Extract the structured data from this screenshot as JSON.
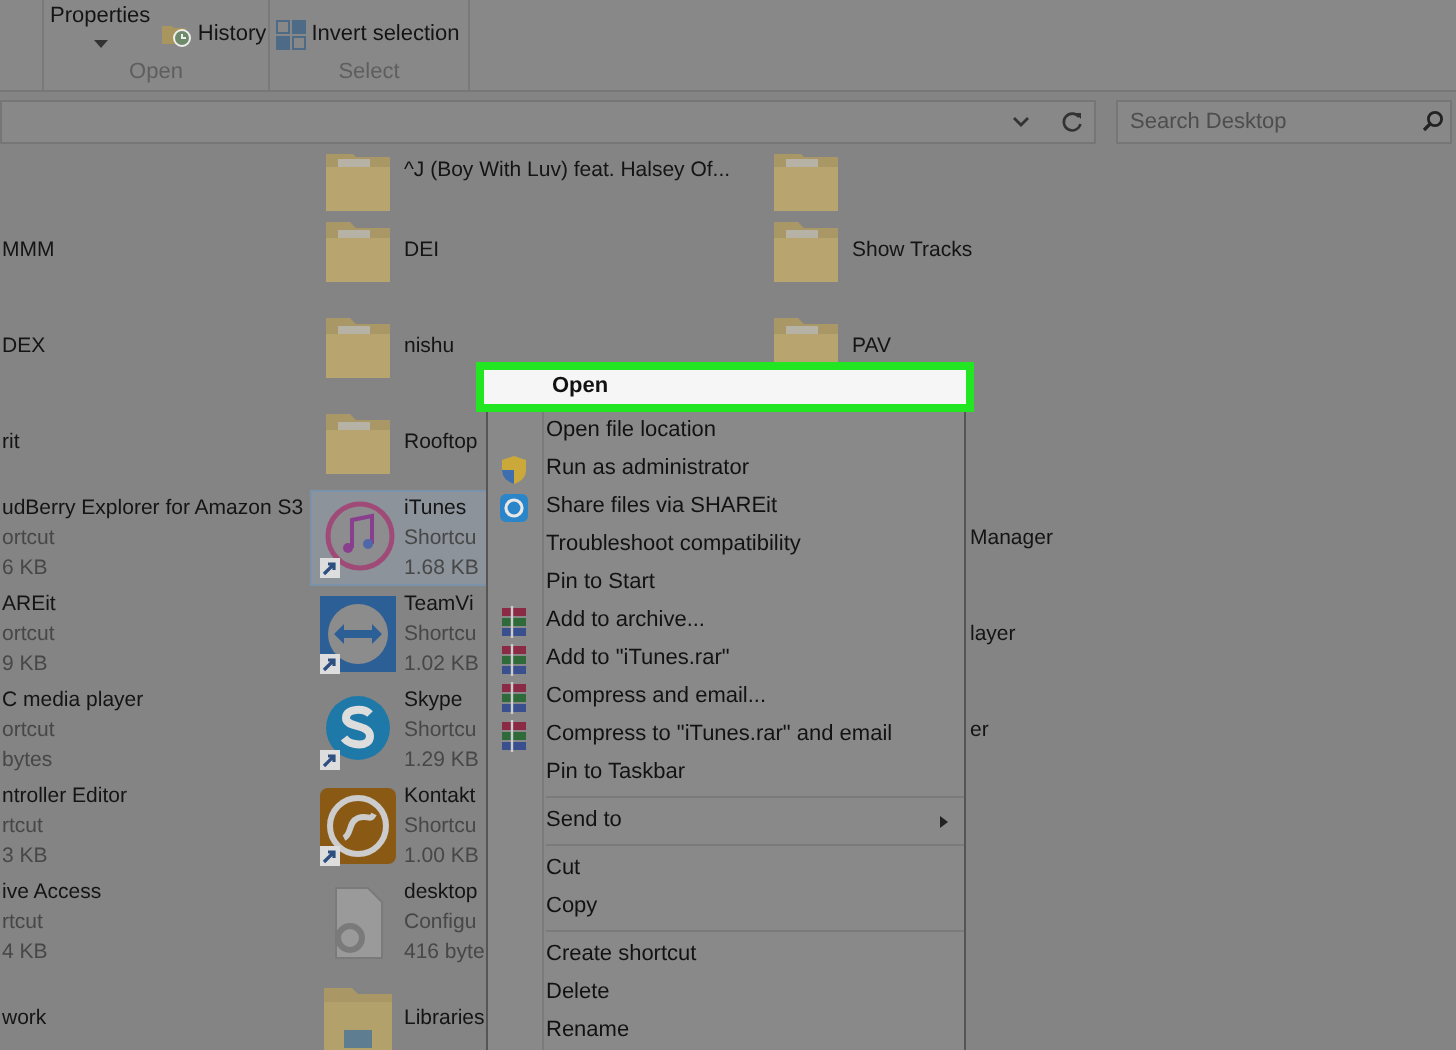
{
  "ribbon": {
    "groups": [
      {
        "label": "Open",
        "buttons": [
          {
            "label": "Properties",
            "kind": "dropdown"
          },
          {
            "label": "History",
            "kind": "clock"
          }
        ]
      },
      {
        "label": "Select",
        "buttons": [
          {
            "label": "Invert selection",
            "kind": "squares"
          }
        ]
      }
    ]
  },
  "address_bar": {
    "search": {
      "placeholder": "Search Desktop"
    }
  },
  "files": {
    "rows": [
      {
        "cells": [
          {
            "kind": "blank"
          },
          {
            "kind": "folder",
            "lines": [
              "^J (Boy With Luv) feat. Halsey  Of..."
            ],
            "selected": false
          },
          {
            "kind": "folder",
            "selected": false
          }
        ]
      },
      {
        "cells": [
          {
            "kind": "text",
            "lines": [
              "MMM"
            ],
            "selected": false
          },
          {
            "kind": "folder",
            "lines": [
              "DEI"
            ],
            "selected": false
          },
          {
            "kind": "folder",
            "lines": [
              "Show Tracks"
            ],
            "selected": false
          }
        ]
      },
      {
        "cells": [
          {
            "kind": "text",
            "lines": [
              "DEX"
            ],
            "selected": false
          },
          {
            "kind": "folder",
            "lines": [
              "nishu"
            ],
            "selected": false
          },
          {
            "kind": "folder",
            "lines": [
              "PAV"
            ],
            "selected": false
          }
        ]
      },
      {
        "cells": [
          {
            "kind": "text",
            "lines": [
              "rit"
            ],
            "selected": false
          },
          {
            "kind": "folder",
            "lines": [
              "Rooftop"
            ],
            "selected": false
          },
          {
            "kind": "blank"
          }
        ]
      },
      {
        "cells": [
          {
            "kind": "text",
            "lines": [
              "udBerry Explorer for Amazon S3",
              "ortcut",
              "6 KB"
            ],
            "selected": false
          },
          {
            "kind": "itunes",
            "lines": [
              "iTunes",
              "Shortcu",
              "1.68 KB"
            ],
            "selected": true
          },
          {
            "kind": "covered",
            "lines": [
              "Manager"
            ],
            "selected": false
          }
        ]
      },
      {
        "cells": [
          {
            "kind": "text",
            "lines": [
              "AREit",
              "ortcut",
              "9 KB"
            ],
            "selected": false
          },
          {
            "kind": "teamviewer",
            "lines": [
              "TeamVi",
              "Shortcu",
              "1.02 KB"
            ],
            "selected": false
          },
          {
            "kind": "covered",
            "lines": [
              "layer"
            ],
            "selected": false
          }
        ]
      },
      {
        "cells": [
          {
            "kind": "text",
            "lines": [
              "C media player",
              "ortcut",
              "bytes"
            ],
            "selected": false
          },
          {
            "kind": "skype",
            "lines": [
              "Skype",
              "Shortcu",
              "1.29 KB"
            ],
            "selected": false
          },
          {
            "kind": "covered",
            "lines": [
              "er"
            ],
            "selected": false
          }
        ]
      },
      {
        "cells": [
          {
            "kind": "text",
            "lines": [
              "ntroller Editor",
              "rtcut",
              "3 KB"
            ],
            "selected": false
          },
          {
            "kind": "kontakt",
            "lines": [
              "Kontakt",
              "Shortcu",
              "1.00 KB"
            ],
            "selected": false
          },
          {
            "kind": "blank"
          }
        ]
      },
      {
        "cells": [
          {
            "kind": "text",
            "lines": [
              "ive Access",
              "rtcut",
              "4 KB"
            ],
            "selected": false
          },
          {
            "kind": "config",
            "lines": [
              "desktop",
              "Configu",
              "416 byte"
            ],
            "selected": false
          },
          {
            "kind": "blank"
          }
        ]
      },
      {
        "cells": [
          {
            "kind": "text",
            "lines": [
              "work"
            ],
            "selected": false
          },
          {
            "kind": "libraries",
            "lines": [
              "Libraries"
            ],
            "selected": false
          },
          {
            "kind": "blank"
          }
        ]
      }
    ]
  },
  "context_menu": {
    "items": [
      {
        "kind": "item",
        "label": "Open",
        "selected": true
      },
      {
        "kind": "item",
        "label": "Open file location",
        "selected": false
      },
      {
        "kind": "shield",
        "label": "Run as administrator",
        "selected": false
      },
      {
        "kind": "shareit",
        "label": "Share files via SHAREit",
        "selected": false
      },
      {
        "kind": "item",
        "label": "Troubleshoot compatibility",
        "selected": false
      },
      {
        "kind": "item",
        "label": "Pin to Start",
        "selected": false
      },
      {
        "kind": "archive",
        "label": "Add to archive...",
        "selected": false
      },
      {
        "kind": "archive",
        "label": "Add to \"iTunes.rar\"",
        "selected": false
      },
      {
        "kind": "archive",
        "label": "Compress and email...",
        "selected": false
      },
      {
        "kind": "archive",
        "label": "Compress to \"iTunes.rar\" and email",
        "selected": false
      },
      {
        "kind": "item",
        "label": "Pin to Taskbar",
        "selected": false
      },
      {
        "kind": "separator"
      },
      {
        "kind": "submenu",
        "label": "Send to",
        "selected": false
      },
      {
        "kind": "separator"
      },
      {
        "kind": "item",
        "label": "Cut",
        "selected": false
      },
      {
        "kind": "item",
        "label": "Copy",
        "selected": false
      },
      {
        "kind": "separator"
      },
      {
        "kind": "item",
        "label": "Create shortcut",
        "selected": false
      },
      {
        "kind": "item",
        "label": "Delete",
        "selected": false
      },
      {
        "kind": "item",
        "label": "Rename",
        "selected": false
      }
    ]
  }
}
